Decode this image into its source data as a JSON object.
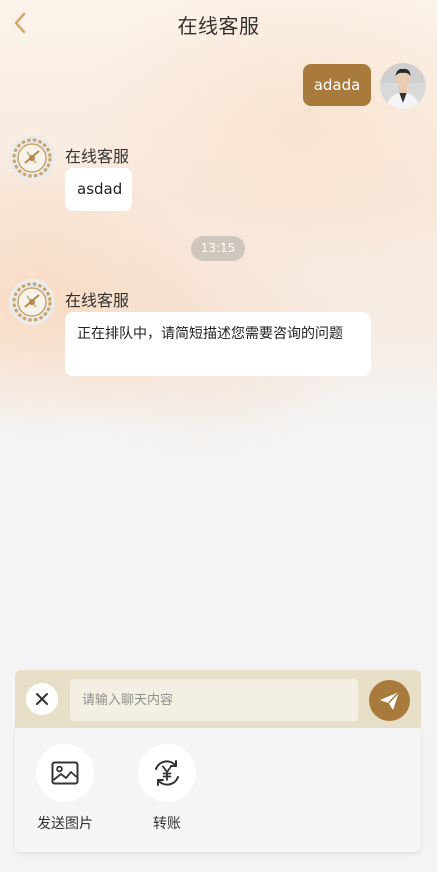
{
  "header": {
    "title": "在线客服",
    "back_icon": "chevron-left-icon"
  },
  "colors": {
    "accent": "#a87a3c",
    "accent_light": "#e8dfc9",
    "back_icon": "#d5a86d"
  },
  "messages": [
    {
      "sender": "me",
      "text": "adada"
    },
    {
      "sender": "agent",
      "name": "在线客服",
      "text": "asdad"
    },
    {
      "sender": "agent",
      "name": "在线客服",
      "text": "正在排队中，请简短描述您需要咨询的问题"
    }
  ],
  "time_divider": "13:15",
  "composer": {
    "placeholder": "请输入聊天内容",
    "value": "",
    "close_icon": "close-icon",
    "send_icon": "paper-plane-icon"
  },
  "tools": [
    {
      "label": "发送图片",
      "icon": "image-icon"
    },
    {
      "label": "转账",
      "icon": "yuan-transfer-icon"
    }
  ]
}
